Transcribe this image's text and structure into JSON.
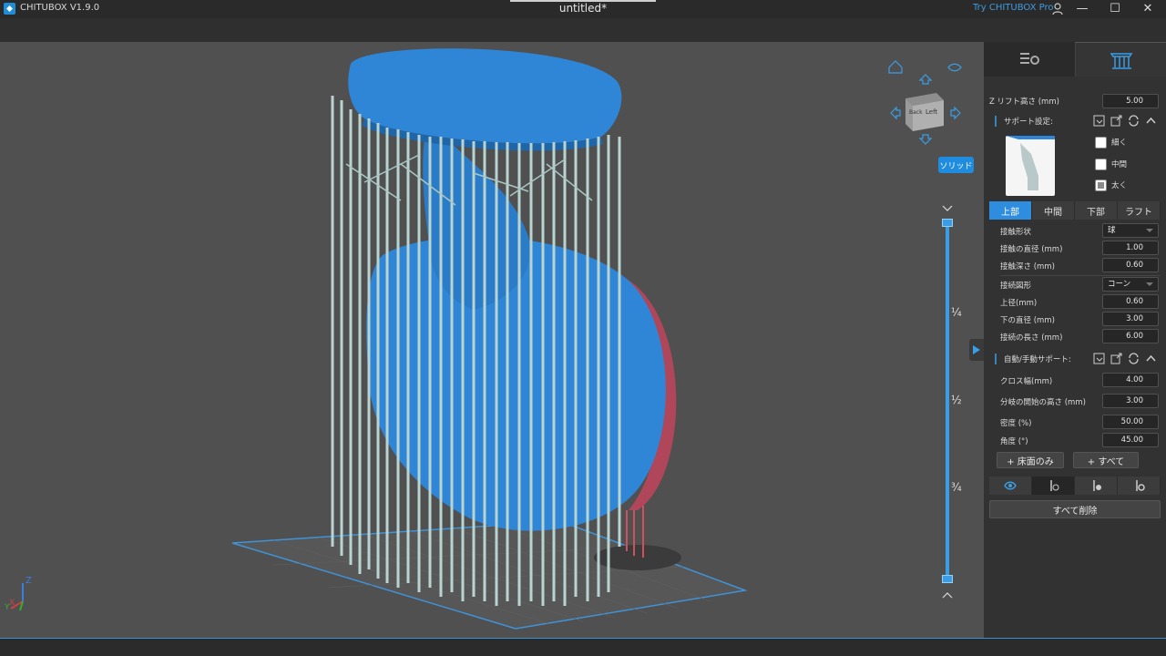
{
  "app": {
    "title": "CHITUBOX V1.9.0",
    "document": "untitled*",
    "try_pro": "Try CHITUBOX Pro"
  },
  "window": {
    "minimize": "—",
    "maximize": "☐",
    "close": "✕"
  },
  "viewport": {
    "solid_label": "ソリッド",
    "slider_marks": [
      "¼",
      "½",
      "¾"
    ],
    "cube_faces": {
      "back": "Back",
      "left": "Left"
    },
    "axes": {
      "z": "Z",
      "x": "X",
      "y": "Y"
    }
  },
  "panel": {
    "z_lift": {
      "label": "Z リフト高さ (mm)",
      "value": "5.00"
    },
    "support_settings": {
      "label": "サポート設定:"
    },
    "presets": [
      {
        "label": "細く",
        "checked": false
      },
      {
        "label": "中間",
        "checked": false
      },
      {
        "label": "太く",
        "checked": true
      }
    ],
    "part_tabs": [
      "上部",
      "中間",
      "下部",
      "ラフト"
    ],
    "active_part_tab": 0,
    "top_settings": [
      {
        "label": "接触形状",
        "value": "球",
        "type": "select"
      },
      {
        "label": "接触の直径 (mm)",
        "value": "1.00",
        "type": "number"
      },
      {
        "label": "接触深さ (mm)",
        "value": "0.60",
        "type": "number"
      },
      {
        "label": "接続図形",
        "value": "コーン",
        "type": "select"
      },
      {
        "label": "上径(mm)",
        "value": "0.60",
        "type": "number"
      },
      {
        "label": "下の直径 (mm)",
        "value": "3.00",
        "type": "number"
      },
      {
        "label": "接続の長さ (mm)",
        "value": "6.00",
        "type": "number"
      }
    ],
    "auto_support": {
      "label": "自動/手動サポート:"
    },
    "auto_settings": [
      {
        "label": "クロス幅(mm)",
        "value": "4.00"
      },
      {
        "label": "分岐の開始の高さ (mm)",
        "value": "3.00"
      },
      {
        "label": "密度 (%)",
        "value": "50.00"
      },
      {
        "label": "角度 (°)",
        "value": "45.00"
      }
    ],
    "buttons": {
      "platform_only": "+ 床面のみ",
      "all": "+ すべて",
      "delete_all": "すべて削除"
    }
  },
  "colors": {
    "accent": "#2f8de0",
    "model": "#2f86d6",
    "support": "#b9d4d0",
    "bed": "#6a6a6a"
  }
}
